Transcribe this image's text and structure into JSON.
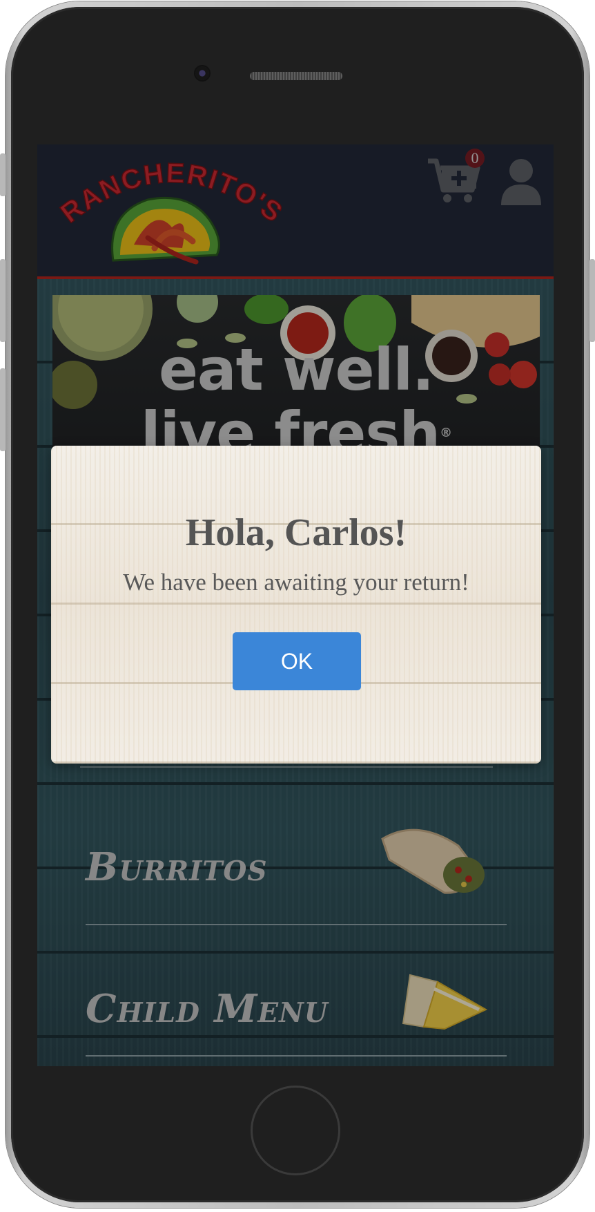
{
  "app": {
    "brand": "RANCHERITO'S",
    "cart_count": "0"
  },
  "banner": {
    "line1": "eat well.",
    "line2": "live fresh",
    "mark": "®"
  },
  "menu": {
    "items": [
      {
        "label": "Burritos"
      },
      {
        "label": "Child Menu"
      }
    ]
  },
  "dialog": {
    "title": "Hola, Carlos!",
    "message": "We have been awaiting your return!",
    "ok_label": "OK"
  },
  "colors": {
    "header_bg": "#232938",
    "header_accent": "#b3261e",
    "ok_button": "#3b86d8",
    "badge_bg": "#7a1d24"
  },
  "icons": {
    "cart": "cart-plus-icon",
    "user": "user-icon"
  }
}
